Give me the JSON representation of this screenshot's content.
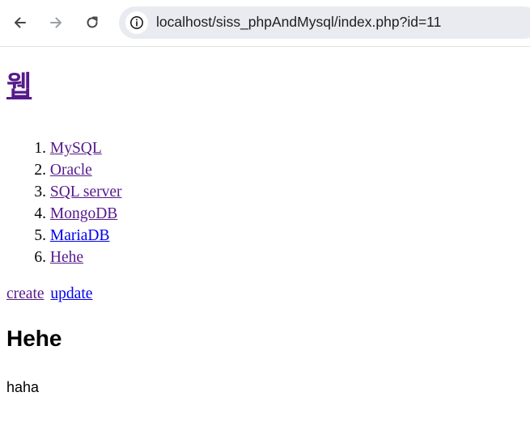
{
  "browser": {
    "back_icon": "arrow-left-icon",
    "forward_icon": "arrow-right-icon",
    "reload_icon": "reload-icon",
    "site_info_icon": "info-icon",
    "url": "localhost/siss_phpAndMysql/index.php?id=11"
  },
  "page": {
    "title": "웹",
    "menu": [
      {
        "number": "1.",
        "label": "MySQL",
        "state": "visited"
      },
      {
        "number": "2.",
        "label": "Oracle",
        "state": "visited"
      },
      {
        "number": "3.",
        "label": "SQL server",
        "state": "visited"
      },
      {
        "number": "4.",
        "label": "MongoDB",
        "state": "visited"
      },
      {
        "number": "5.",
        "label": "MariaDB",
        "state": "unvisited"
      },
      {
        "number": "6.",
        "label": "Hehe",
        "state": "visited"
      }
    ],
    "create_label": "create",
    "update_label": "update",
    "doc_title": "Hehe",
    "doc_body": "haha"
  },
  "colors": {
    "visited_link": "#551a8b",
    "unvisited_link": "#0000ee",
    "addressbar_bg": "#e9ebf1"
  }
}
